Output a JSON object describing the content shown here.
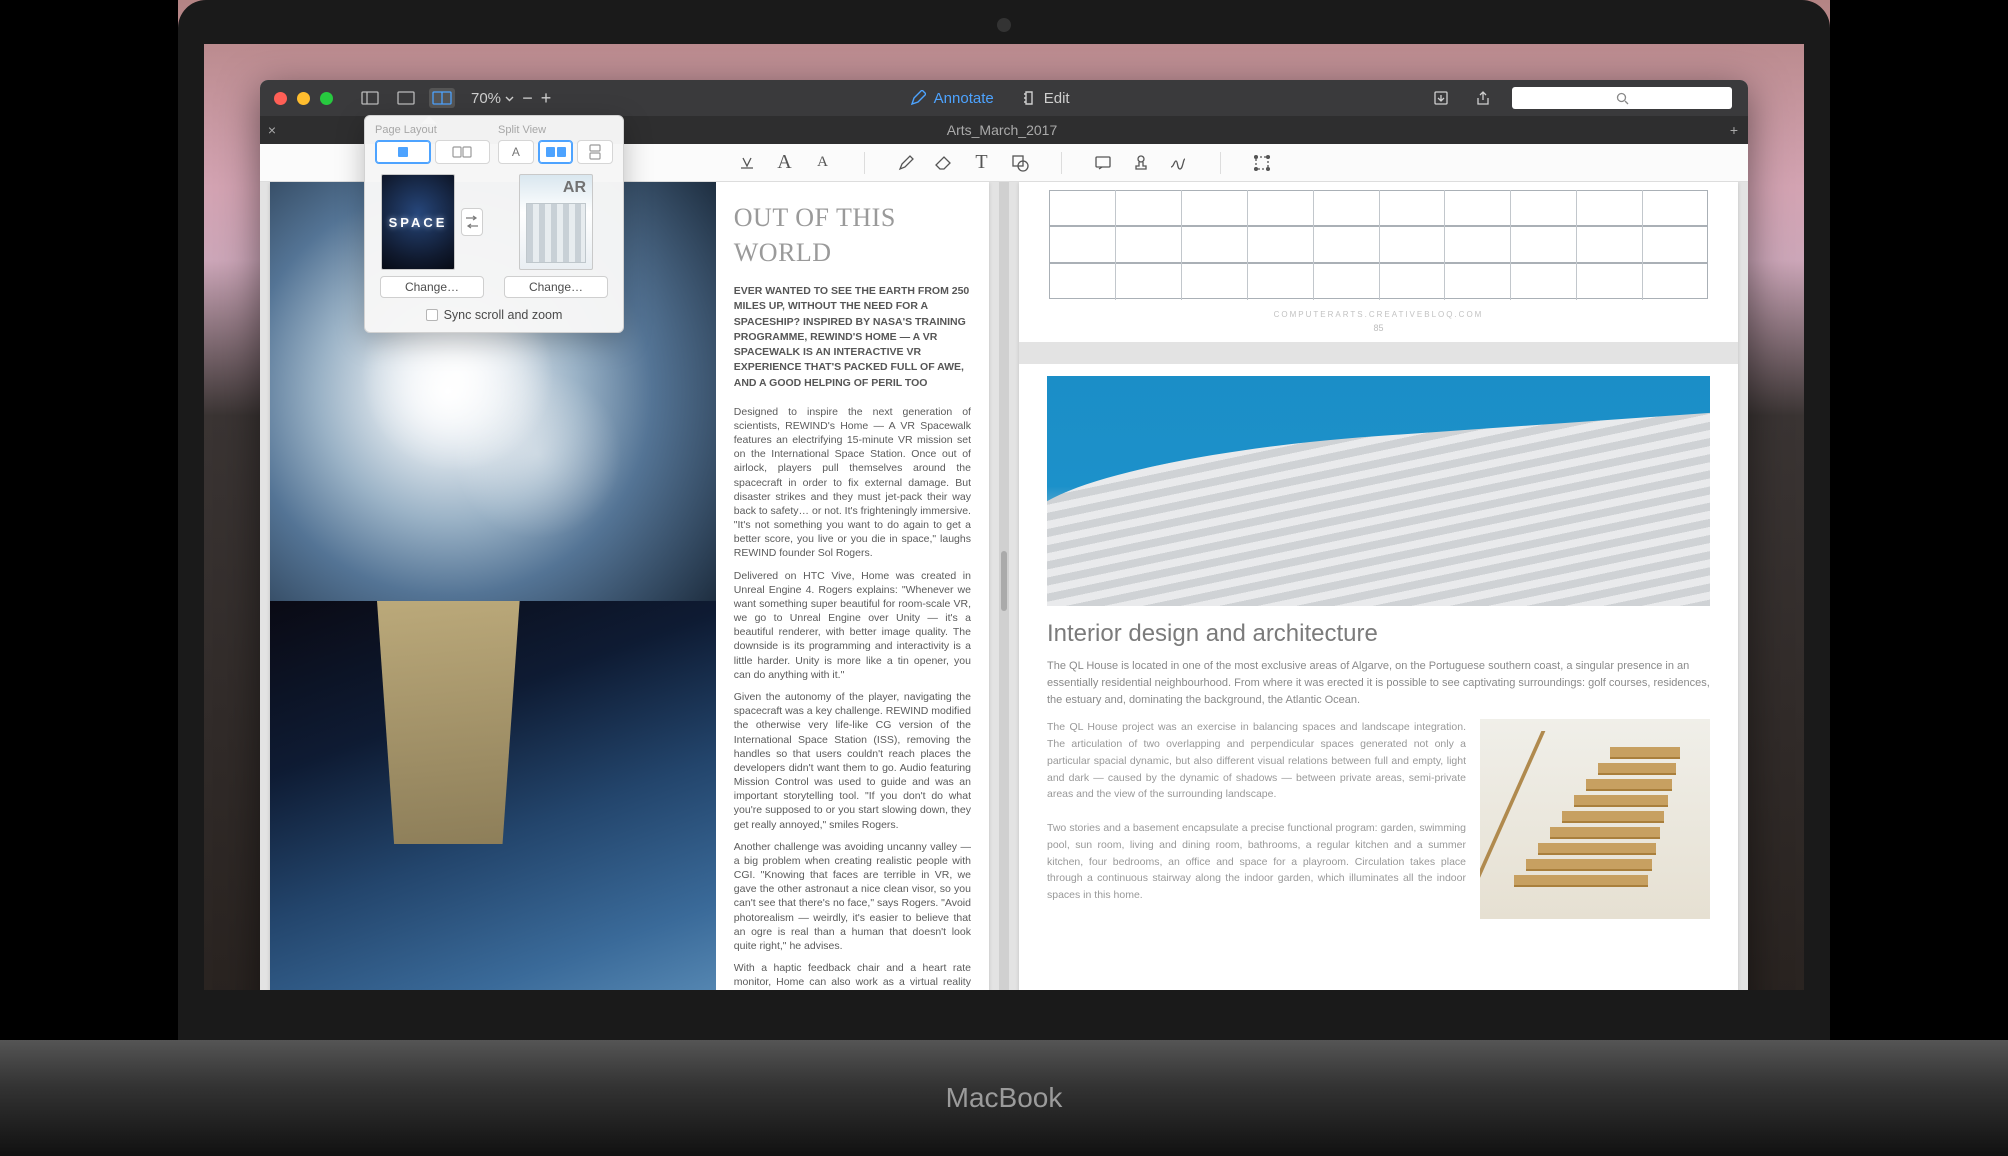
{
  "macbook": {
    "label": "MacBook"
  },
  "titlebar": {
    "zoom_value": "70%",
    "annotate_label": "Annotate",
    "edit_label": "Edit"
  },
  "tab": {
    "title": "Arts_March_2017"
  },
  "popover": {
    "page_layout_label": "Page Layout",
    "split_view_label": "Split View",
    "thumb_left_text": "SPACE",
    "thumb_right_badge": "AR",
    "change_label": "Change…",
    "sync_label": "Sync scroll and zoom"
  },
  "left_doc": {
    "headline": "OUT OF THIS WORLD",
    "lead": "EVER WANTED TO SEE THE EARTH FROM 250 MILES UP, WITHOUT THE NEED FOR A SPACESHIP? INSPIRED BY NASA'S TRAINING PROGRAMME, REWIND'S HOME — A VR SPACEWALK IS AN INTERACTIVE VR EXPERIENCE THAT'S PACKED FULL OF AWE, AND A GOOD HELPING OF PERIL TOO",
    "p1": "Designed to inspire the next generation of scientists, REWIND's Home — A VR Spacewalk features an electrifying 15-minute VR mission set on the International Space Station. Once out of airlock, players pull themselves around the spacecraft in order to fix external damage. But disaster strikes and they must jet-pack their way back to safety… or not. It's frighteningly immersive. \"It's not something you want to do again to get a better score, you live or you die in space,\" laughs REWIND founder Sol Rogers.",
    "p2": "Delivered on HTC Vive, Home was created in Unreal Engine 4. Rogers explains: \"Whenever we want something super beautiful for room-scale VR, we go to Unreal Engine over Unity — it's a beautiful renderer, with better image quality. The downside is its programming and interactivity is a little harder. Unity is more like a tin opener, you can do anything with it.\"",
    "p3": "Given the autonomy of the player, navigating the spacecraft was a key challenge. REWIND modified the otherwise very life-like CG version of the International Space Station (ISS), removing the handles so that users couldn't reach places the developers didn't want them to go. Audio featuring Mission Control was used to guide and was an important storytelling tool. \"If you don't do what you're supposed to or you start slowing down, they get really annoyed,\" smiles Rogers.",
    "p4": "Another challenge was avoiding uncanny valley — a big problem when creating realistic people with CGI. \"Knowing that faces are terrible in VR, we gave the other astronaut a nice clean visor, so you can't see that there's no face,\" says Rogers. \"Avoid photorealism — weirdly, it's easier to believe that an ogre is real than a human that doesn't look quite right,\" he advises.",
    "p5": "With a haptic feedback chair and a heart rate monitor, Home can also work as a virtual reality installation that feeds back the users' own"
  },
  "right_doc": {
    "elev_site": "COMPUTERARTS.CREATIVEBLOQ.COM",
    "elev_page": "85",
    "heading": "Interior design and architecture",
    "intro": "The QL House is located in one of the most exclusive areas of Algarve, on the Portuguese southern coast, a singular presence in an essentially residential neighbourhood. From where it was erected it is possible to see captivating surroundings: golf courses, residences, the estuary and, dominating the background, the Atlantic Ocean.",
    "col1": "The QL House project was an exercise in balancing spaces and landscape integration. The articulation of two overlapping and perpendicular spaces generated not only a particular spacial dynamic, but also different visual relations between full and empty, light and dark — caused by the dynamic of shadows — between private areas, semi-private areas and the view of the surrounding landscape.",
    "col2": "Two stories and a basement encapsulate a precise functional program: garden, swimming pool, sun room, living and dining room, bathrooms, a regular kitchen and a summer kitchen, four bedrooms, an office and space for a playroom. Circulation takes place through a continuous stairway along the indoor garden, which illuminates all the indoor spaces in this home."
  }
}
